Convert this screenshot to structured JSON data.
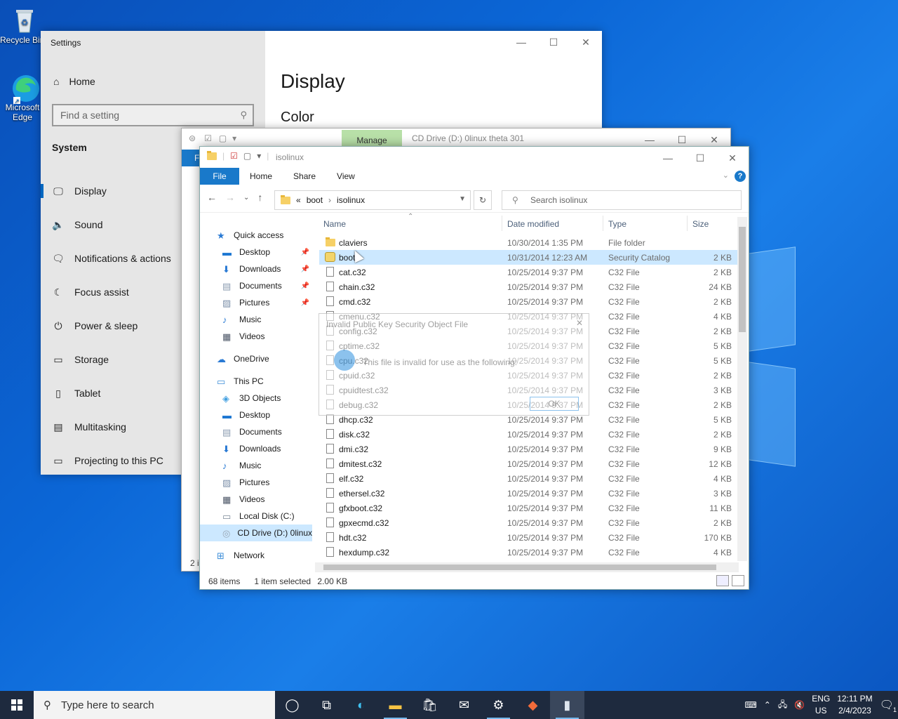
{
  "desktop": {
    "icons": [
      {
        "label": "Recycle Bin",
        "icon": "recycle-bin-icon"
      },
      {
        "label": "Microsoft Edge",
        "icon": "edge-icon"
      }
    ]
  },
  "settings": {
    "title": "Settings",
    "home": "Home",
    "search_placeholder": "Find a setting",
    "section": "System",
    "nav": [
      {
        "label": "Display",
        "icon": "monitor-icon",
        "glyph": "🖵"
      },
      {
        "label": "Sound",
        "icon": "speaker-icon",
        "glyph": "🔈"
      },
      {
        "label": "Notifications & actions",
        "icon": "notification-icon",
        "glyph": "🗨"
      },
      {
        "label": "Focus assist",
        "icon": "moon-icon",
        "glyph": "☾"
      },
      {
        "label": "Power & sleep",
        "icon": "power-icon",
        "glyph": "⏻"
      },
      {
        "label": "Storage",
        "icon": "storage-icon",
        "glyph": "▭"
      },
      {
        "label": "Tablet",
        "icon": "tablet-icon",
        "glyph": "▯"
      },
      {
        "label": "Multitasking",
        "icon": "multitasking-icon",
        "glyph": "▤"
      },
      {
        "label": "Projecting to this PC",
        "icon": "projector-icon",
        "glyph": "▭"
      }
    ],
    "page_heading": "Display",
    "page_sub": "Color"
  },
  "back_explorer": {
    "manage_tab": "Manage",
    "title": "CD Drive (D:) 0linux theta 301",
    "file_tab_fragment": "F",
    "status_fragment": "2 i"
  },
  "explorer": {
    "title": "isolinux",
    "ribbon": {
      "file": "File",
      "tabs": [
        "Home",
        "Share",
        "View"
      ],
      "help": "?"
    },
    "address": {
      "prefix": "«",
      "crumbs": [
        "boot",
        "isolinux"
      ],
      "sep": "›"
    },
    "search_placeholder": "Search isolinux",
    "tree": [
      {
        "label": "Quick access",
        "icon": "star-icon",
        "indent": 1,
        "pin": false
      },
      {
        "label": "Desktop",
        "icon": "desktop-icon",
        "indent": 2,
        "pin": true
      },
      {
        "label": "Downloads",
        "icon": "download-icon",
        "indent": 2,
        "pin": true
      },
      {
        "label": "Documents",
        "icon": "documents-icon",
        "indent": 2,
        "pin": true
      },
      {
        "label": "Pictures",
        "icon": "pictures-icon",
        "indent": 2,
        "pin": true
      },
      {
        "label": "Music",
        "icon": "music-icon",
        "indent": 2,
        "pin": false
      },
      {
        "label": "Videos",
        "icon": "videos-icon",
        "indent": 2,
        "pin": false
      },
      {
        "label": "",
        "icon": "",
        "indent": 0,
        "pin": false,
        "spacer": true
      },
      {
        "label": "OneDrive",
        "icon": "cloud-icon",
        "indent": 1,
        "pin": false
      },
      {
        "label": "",
        "icon": "",
        "indent": 0,
        "pin": false,
        "spacer": true
      },
      {
        "label": "This PC",
        "icon": "pc-icon",
        "indent": 1,
        "pin": false
      },
      {
        "label": "3D Objects",
        "icon": "cube-icon",
        "indent": 2,
        "pin": false
      },
      {
        "label": "Desktop",
        "icon": "desktop-icon",
        "indent": 2,
        "pin": false
      },
      {
        "label": "Documents",
        "icon": "documents-icon",
        "indent": 2,
        "pin": false
      },
      {
        "label": "Downloads",
        "icon": "download-icon",
        "indent": 2,
        "pin": false
      },
      {
        "label": "Music",
        "icon": "music-icon",
        "indent": 2,
        "pin": false
      },
      {
        "label": "Pictures",
        "icon": "pictures-icon",
        "indent": 2,
        "pin": false
      },
      {
        "label": "Videos",
        "icon": "videos-icon",
        "indent": 2,
        "pin": false
      },
      {
        "label": "Local Disk (C:)",
        "icon": "disk-icon",
        "indent": 2,
        "pin": false
      },
      {
        "label": "CD Drive (D:) 0linux",
        "icon": "cd-drive-icon",
        "indent": 2,
        "pin": false,
        "selected": true
      },
      {
        "label": "",
        "icon": "",
        "indent": 0,
        "pin": false,
        "spacer": true
      },
      {
        "label": "Network",
        "icon": "network-icon",
        "indent": 1,
        "pin": false
      }
    ],
    "columns": {
      "name": "Name",
      "date": "Date modified",
      "type": "Type",
      "size": "Size"
    },
    "files": [
      {
        "name": "claviers",
        "date": "10/30/2014 1:35 PM",
        "type": "File folder",
        "size": "",
        "kind": "folder"
      },
      {
        "name": "boot",
        "date": "10/31/2014 12:23 AM",
        "type": "Security Catalog",
        "size": "2 KB",
        "kind": "catalog",
        "selected": true
      },
      {
        "name": "cat.c32",
        "date": "10/25/2014 9:37 PM",
        "type": "C32 File",
        "size": "2 KB",
        "kind": "file"
      },
      {
        "name": "chain.c32",
        "date": "10/25/2014 9:37 PM",
        "type": "C32 File",
        "size": "24 KB",
        "kind": "file"
      },
      {
        "name": "cmd.c32",
        "date": "10/25/2014 9:37 PM",
        "type": "C32 File",
        "size": "2 KB",
        "kind": "file"
      },
      {
        "name": "cmenu.c32",
        "date": "10/25/2014 9:37 PM",
        "type": "C32 File",
        "size": "4 KB",
        "kind": "file"
      },
      {
        "name": "config.c32",
        "date": "10/25/2014 9:37 PM",
        "type": "C32 File",
        "size": "2 KB",
        "kind": "file"
      },
      {
        "name": "cptime.c32",
        "date": "10/25/2014 9:37 PM",
        "type": "C32 File",
        "size": "5 KB",
        "kind": "file"
      },
      {
        "name": "cpu.c32",
        "date": "10/25/2014 9:37 PM",
        "type": "C32 File",
        "size": "5 KB",
        "kind": "file"
      },
      {
        "name": "cpuid.c32",
        "date": "10/25/2014 9:37 PM",
        "type": "C32 File",
        "size": "2 KB",
        "kind": "file"
      },
      {
        "name": "cpuidtest.c32",
        "date": "10/25/2014 9:37 PM",
        "type": "C32 File",
        "size": "3 KB",
        "kind": "file"
      },
      {
        "name": "debug.c32",
        "date": "10/25/2014 9:37 PM",
        "type": "C32 File",
        "size": "2 KB",
        "kind": "file"
      },
      {
        "name": "dhcp.c32",
        "date": "10/25/2014 9:37 PM",
        "type": "C32 File",
        "size": "5 KB",
        "kind": "file"
      },
      {
        "name": "disk.c32",
        "date": "10/25/2014 9:37 PM",
        "type": "C32 File",
        "size": "2 KB",
        "kind": "file"
      },
      {
        "name": "dmi.c32",
        "date": "10/25/2014 9:37 PM",
        "type": "C32 File",
        "size": "9 KB",
        "kind": "file"
      },
      {
        "name": "dmitest.c32",
        "date": "10/25/2014 9:37 PM",
        "type": "C32 File",
        "size": "12 KB",
        "kind": "file"
      },
      {
        "name": "elf.c32",
        "date": "10/25/2014 9:37 PM",
        "type": "C32 File",
        "size": "4 KB",
        "kind": "file"
      },
      {
        "name": "ethersel.c32",
        "date": "10/25/2014 9:37 PM",
        "type": "C32 File",
        "size": "3 KB",
        "kind": "file"
      },
      {
        "name": "gfxboot.c32",
        "date": "10/25/2014 9:37 PM",
        "type": "C32 File",
        "size": "11 KB",
        "kind": "file"
      },
      {
        "name": "gpxecmd.c32",
        "date": "10/25/2014 9:37 PM",
        "type": "C32 File",
        "size": "2 KB",
        "kind": "file"
      },
      {
        "name": "hdt.c32",
        "date": "10/25/2014 9:37 PM",
        "type": "C32 File",
        "size": "170 KB",
        "kind": "file"
      },
      {
        "name": "hexdump.c32",
        "date": "10/25/2014 9:37 PM",
        "type": "C32 File",
        "size": "4 KB",
        "kind": "file"
      }
    ],
    "status": {
      "count": "68 items",
      "selection": "1 item selected",
      "size": "2.00 KB"
    }
  },
  "ghost_dialog": {
    "title": "Invalid Public Key Security Object File",
    "message": "This file is invalid for use as the following:",
    "ok": "OK"
  },
  "taskbar": {
    "search_placeholder": "Type here to search",
    "apps": [
      "cortana-icon",
      "task-view-icon",
      "edge-icon",
      "file-explorer-icon",
      "store-icon",
      "mail-icon",
      "settings-icon",
      "paint-icon",
      "notepad-icon"
    ],
    "lang_top": "ENG",
    "lang_bottom": "US",
    "time": "12:11 PM",
    "date": "2/4/2023",
    "notification_count": "1"
  },
  "colors": {
    "accent": "#1979ca",
    "selection": "#cce8ff",
    "manage": "#b8e0a8"
  }
}
